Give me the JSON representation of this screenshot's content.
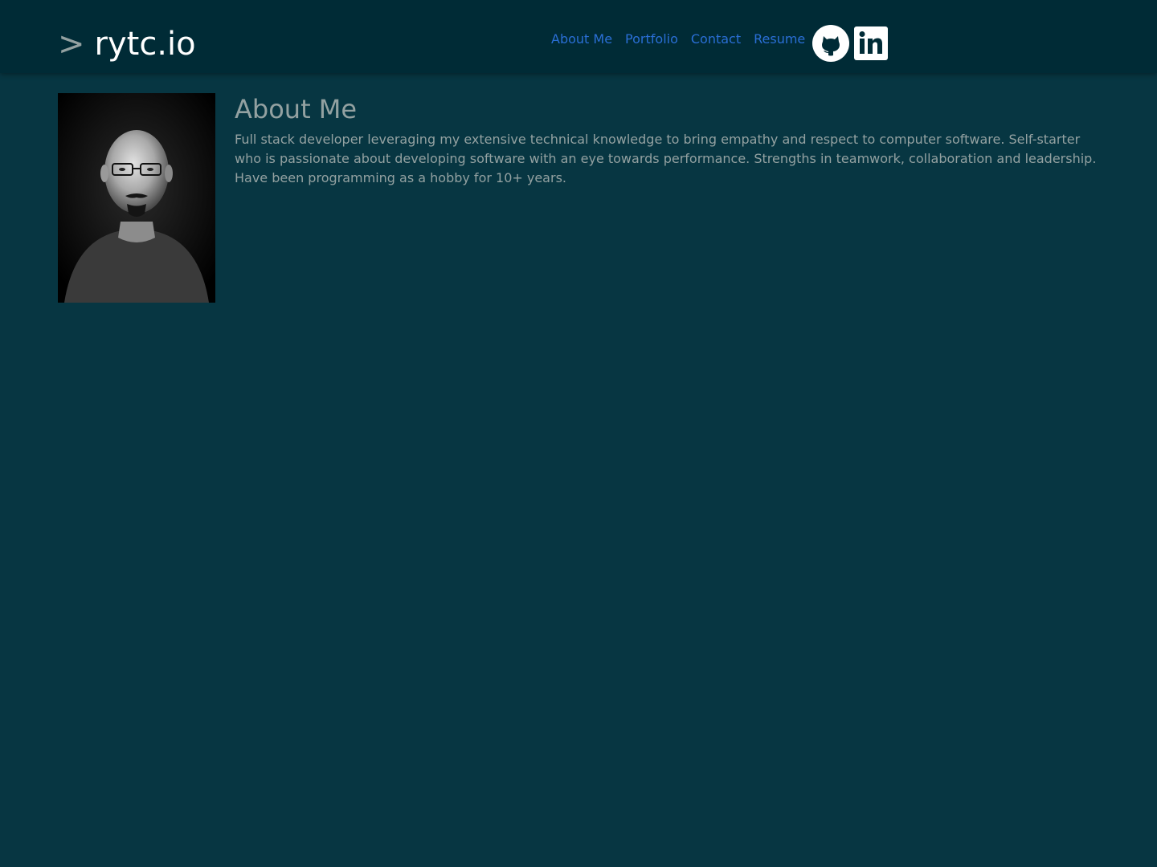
{
  "header": {
    "prompt": ">",
    "brand": "rytc.io",
    "nav": [
      {
        "label": "About Me"
      },
      {
        "label": "Portfolio"
      },
      {
        "label": "Contact"
      },
      {
        "label": "Resume"
      }
    ],
    "social": [
      {
        "icon": "github-icon"
      },
      {
        "icon": "linkedin-icon"
      }
    ]
  },
  "about": {
    "title": "About Me",
    "body": "Full stack developer leveraging my extensive technical knowledge to bring empathy and respect to computer software. Self-starter who is passionate about developing software with an eye towards performance. Strengths in teamwork, collaboration and leadership. Have been programming as a hobby for 10+ years."
  },
  "colors": {
    "header_bg": "#002b36",
    "page_bg": "#073642",
    "link": "#2a6fd6",
    "text": "#93a1a1",
    "brand": "#ffffff"
  }
}
